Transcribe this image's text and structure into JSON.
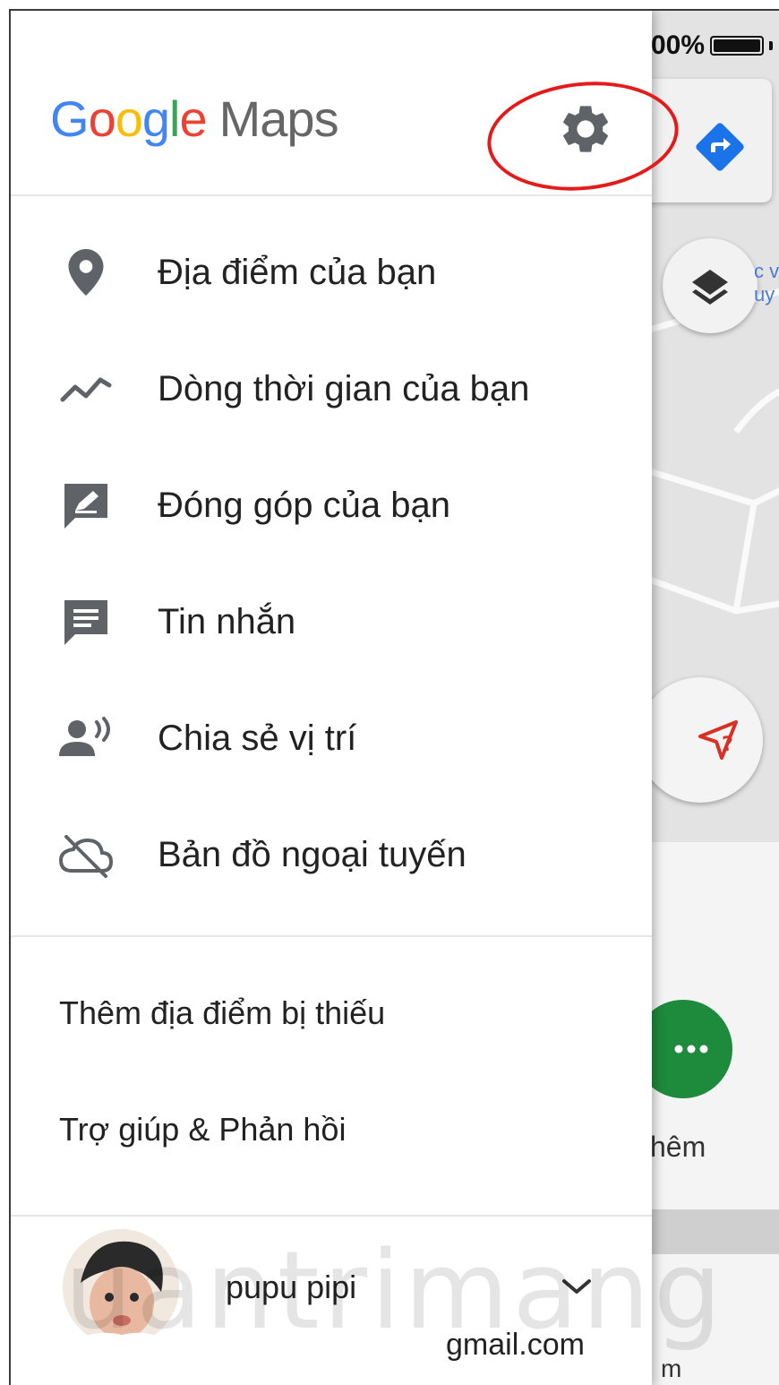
{
  "status_bar": {
    "battery_text": "00%"
  },
  "app": {
    "logo_letters": [
      "G",
      "o",
      "o",
      "g",
      "l",
      "e"
    ],
    "logo_suffix": "Maps"
  },
  "menu": {
    "items": [
      {
        "label": "Địa điểm của bạn",
        "icon": "location-pin-icon"
      },
      {
        "label": "Dòng thời gian của bạn",
        "icon": "timeline-icon"
      },
      {
        "label": "Đóng góp của bạn",
        "icon": "contribute-icon"
      },
      {
        "label": "Tin nhắn",
        "icon": "message-icon"
      },
      {
        "label": "Chia sẻ vị trí",
        "icon": "location-sharing-icon"
      },
      {
        "label": "Bản đồ ngoại tuyến",
        "icon": "offline-cloud-icon"
      }
    ],
    "secondary": [
      {
        "label": "Thêm địa điểm bị thiếu"
      },
      {
        "label": "Trợ giúp & Phản hồi"
      }
    ]
  },
  "account": {
    "name": "pupu pipi",
    "email": "gmail.com"
  },
  "map": {
    "poi_label": "c v\nuy",
    "more_label": "hêm",
    "bottom_text": "m"
  },
  "watermark": "uantrimang",
  "colors": {
    "annotation": "#e31b1b",
    "directions": "#1a73e8",
    "more_button": "#1e8a3c",
    "explore": "#d93025"
  }
}
